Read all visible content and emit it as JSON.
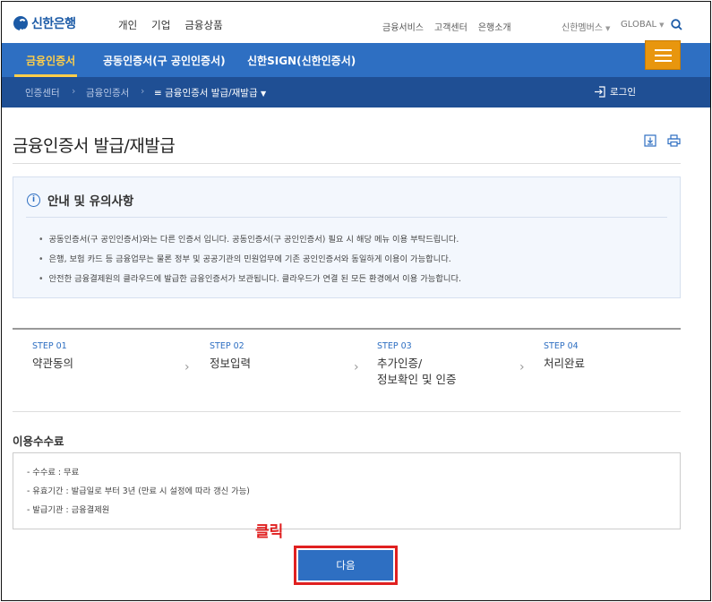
{
  "brand": {
    "name": "신한은행",
    "color": "#1b5aa6"
  },
  "main_nav": [
    "개인",
    "기업",
    "금융상품"
  ],
  "util_nav": [
    "금융서비스",
    "고객센터",
    "은행소개"
  ],
  "member_menu": "신한멤버스",
  "global_menu": "GLOBAL",
  "blue_nav": {
    "items": [
      "금융인증서",
      "공동인증서(구 공인인증서)",
      "신한SIGN(신한인증서)"
    ],
    "active_index": 0,
    "accent": "#ffcf4a"
  },
  "breadcrumb": {
    "items": [
      "인증센터",
      "금융인증서"
    ],
    "current": "금융인증서 발급/재발급",
    "login_label": "로그인"
  },
  "page_title": "금융인증서 발급/재발급",
  "notice": {
    "title": "안내 및 유의사항",
    "items": [
      "공동인증서(구 공인인증서)와는 다른 인증서 입니다. 공동인증서(구 공인인증서) 필요 시 해당 메뉴 이용 부탁드립니다.",
      "은행, 보험 카드 등 금융업무는 물론 정부 및 공공기관의 민원업무에 기존 공인인증서와 동일하게 이용이 가능합니다.",
      "안전한 금융결제원의 클라우드에 발급한 금융인증서가 보관됩니다. 클라우드가 연결 된 모든 환경에서 이용 가능합니다."
    ]
  },
  "steps": [
    {
      "no": "STEP 01",
      "label": "약관동의"
    },
    {
      "no": "STEP 02",
      "label": "정보입력"
    },
    {
      "no": "STEP 03",
      "label": "추가인증/",
      "label2": "정보확인 및 인증"
    },
    {
      "no": "STEP 04",
      "label": "처리완료"
    }
  ],
  "fee": {
    "title": "이용수수료",
    "items": [
      "- 수수료 : 무료",
      "- 유효기간 : 발급일로 부터 3년 (만료 시 설정에 따라 갱신 가능)",
      "- 발급기관 : 금융결제원"
    ]
  },
  "annotation": {
    "text": "클릭",
    "color": "#e02020"
  },
  "next_button": "다음"
}
